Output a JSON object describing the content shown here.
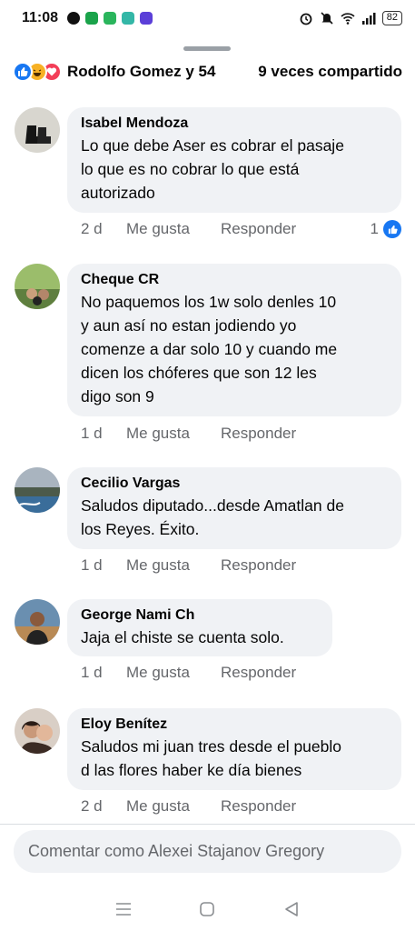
{
  "status": {
    "time": "11:08",
    "battery": "82",
    "app_icons": [
      "messenger-icon",
      "shield-green-icon",
      "app-green-icon",
      "app-teal-icon",
      "app-purple-icon"
    ],
    "system_icons": [
      "alarm-icon",
      "mute-icon",
      "wifi-icon",
      "signal-icon"
    ]
  },
  "header": {
    "reactions": [
      "like",
      "haha",
      "love"
    ],
    "reactors_text": "Rodolfo Gomez y 54",
    "shares_text": "9 veces compartido"
  },
  "comments": [
    {
      "name": "Isabel Mendoza",
      "lines": [
        "Lo que debe Aser es cobrar el pasaje",
        "lo que es no cobrar lo que está",
        "autorizado"
      ],
      "age": "2 d",
      "like_label": "Me gusta",
      "reply_label": "Responder",
      "reaction_count": "1"
    },
    {
      "name": "Cheque CR",
      "lines": [
        "No paquemos los 1w solo denles 10",
        "y aun así no estan jodiendo yo",
        "comenze a dar solo 10 y cuando me",
        "dicen los chóferes que son 12 les",
        "digo son 9"
      ],
      "age": "1 d",
      "like_label": "Me gusta",
      "reply_label": "Responder"
    },
    {
      "name": "Cecilio Vargas",
      "lines": [
        "Saludos diputado...desde Amatlan de",
        "los Reyes. Éxito."
      ],
      "age": "1 d",
      "like_label": "Me gusta",
      "reply_label": "Responder"
    },
    {
      "name": "George Nami Ch",
      "lines": [
        "Jaja el chiste se cuenta solo."
      ],
      "age": "1 d",
      "like_label": "Me gusta",
      "reply_label": "Responder"
    },
    {
      "name": "Eloy Benítez",
      "lines": [
        "Saludos mi juan tres desde el pueblo",
        "d las flores haber ke día bienes"
      ],
      "age": "2 d",
      "like_label": "Me gusta",
      "reply_label": "Responder"
    }
  ],
  "composer": {
    "placeholder": "Comentar como Alexei Stajanov Gregory"
  },
  "nav": {
    "buttons": [
      "menu-icon",
      "home-icon",
      "back-icon"
    ]
  },
  "colors": {
    "accent": "#1877f2",
    "bubble": "#f0f2f5",
    "muted_text": "#65676b"
  }
}
